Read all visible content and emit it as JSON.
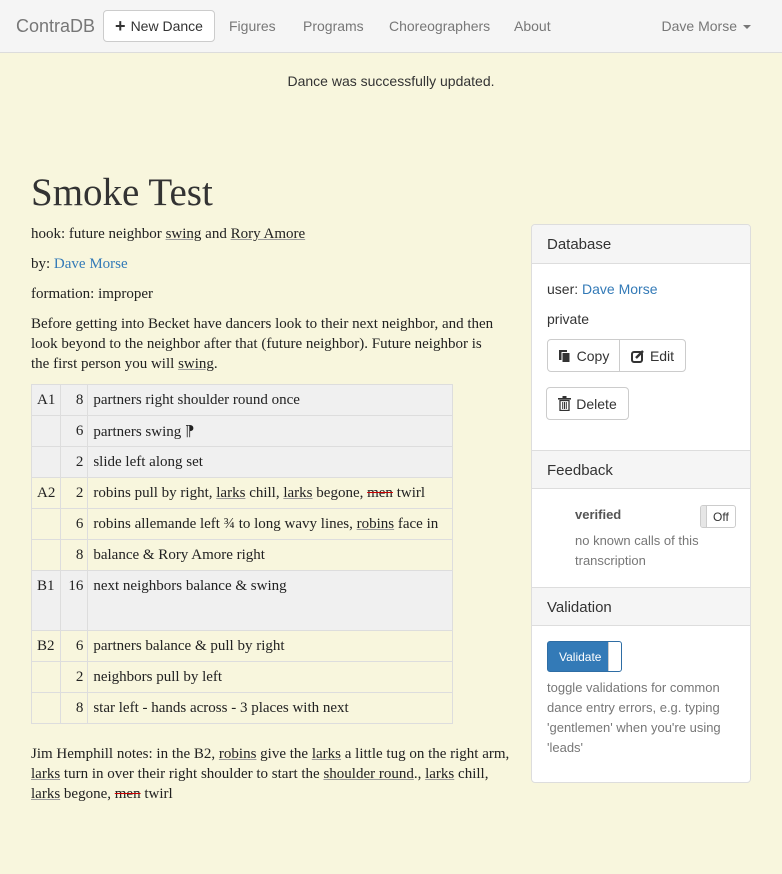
{
  "navbar": {
    "brand": "ContraDB",
    "new_dance_label": "New Dance",
    "links": [
      "Figures",
      "Programs",
      "Choreographers",
      "About"
    ],
    "user_name": "Dave Morse"
  },
  "notice": "Dance was successfully updated.",
  "dance": {
    "title": "Smoke Test",
    "hook_label": "hook: future neighbor ",
    "hook_swing": "swing",
    "hook_and": " and ",
    "hook_rory": "Rory Amore",
    "by_label": "by: ",
    "by_name": "Dave Morse",
    "formation": "formation: improper",
    "preamble_1": "Before getting into Becket have dancers look to their next neighbor, and then look beyond to the neighbor after that (future neighbor). Future neighbor is the first person you will ",
    "preamble_swing": "swing",
    "preamble_end": "."
  },
  "figures": [
    {
      "section": "A1",
      "beats": "8",
      "text": "partners right shoulder round once"
    },
    {
      "section": "",
      "beats": "6",
      "text": "partners swing ⁋"
    },
    {
      "section": "",
      "beats": "2",
      "text": "slide left along set"
    },
    {
      "section": "A2",
      "beats": "2",
      "parts": [
        "robins pull by right, ",
        "larks",
        " chill, ",
        "larks",
        " begone, ",
        "men",
        " twirl"
      ]
    },
    {
      "section": "",
      "beats": "6",
      "parts": [
        "robins allemande left ¾ to long wavy lines, ",
        "robins",
        " face in"
      ]
    },
    {
      "section": "",
      "beats": "8",
      "text": "balance & Rory Amore right"
    },
    {
      "section": "B1",
      "beats": "16",
      "text": "next neighbors balance & swing"
    },
    {
      "section": "B2",
      "beats": "6",
      "text": "partners balance & pull by right"
    },
    {
      "section": "",
      "beats": "2",
      "text": "neighbors pull by left"
    },
    {
      "section": "",
      "beats": "8",
      "text": "star left - hands across - 3 places with next"
    }
  ],
  "notes": {
    "p1": "Jim Hemphill notes: in the B2, ",
    "robins": "robins",
    "p2": " give the ",
    "larks1": "larks",
    "p3": " a little tug on the right arm, ",
    "larks2": "larks",
    "p4": " turn in over their right shoulder to start the ",
    "shoulder_round": "shoulder round",
    "p5": "., ",
    "larks3": "larks",
    "p6": " chill, ",
    "larks4": "larks",
    "p7": " begone, ",
    "men": "men",
    "p8": " twirl"
  },
  "sidebar": {
    "database_heading": "Database",
    "user_label": "user: ",
    "user_name": "Dave Morse",
    "visibility": "private",
    "copy_label": "Copy",
    "edit_label": "Edit",
    "delete_label": "Delete",
    "feedback_heading": "Feedback",
    "verified_label": "verified",
    "verified_toggle": "Off",
    "verified_note": "no known calls of this transcription",
    "validation_heading": "Validation",
    "validate_label": "Validate",
    "validate_note": "toggle validations for common dance entry errors, e.g. typing 'gentlemen' when you're using 'leads'"
  }
}
